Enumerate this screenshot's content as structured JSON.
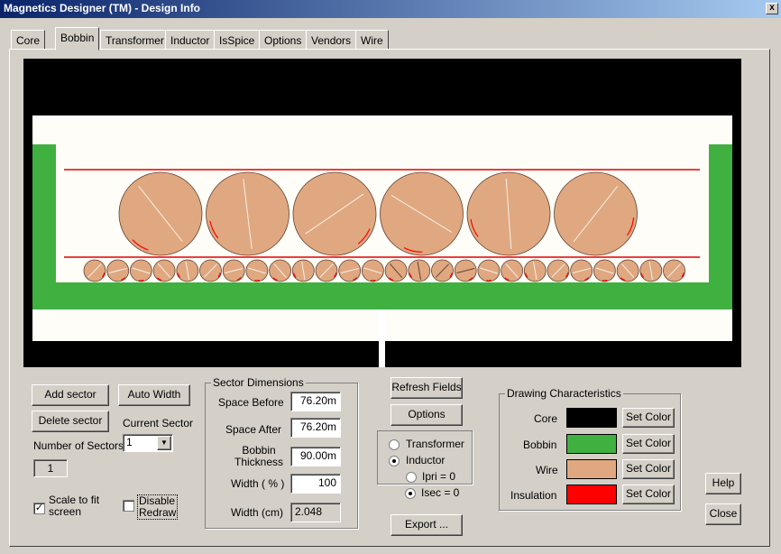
{
  "window": {
    "title": "Magnetics Designer (TM) - Design Info",
    "close_glyph": "x"
  },
  "tabs": [
    "Core",
    "Bobbin",
    "Transformer",
    "Inductor",
    "IsSpice",
    "Options",
    "Vendors",
    "Wire"
  ],
  "buttons": {
    "add_sector": "Add sector",
    "auto_width": "Auto Width",
    "delete_sector": "Delete sector",
    "refresh_fields": "Refresh Fields",
    "options": "Options",
    "export": "Export ...",
    "help": "Help",
    "close": "Close",
    "set_color": "Set Color"
  },
  "labels": {
    "current_sector": "Current Sector",
    "number_of_sectors": "Number of Sectors",
    "scale_to_fit": "Scale to fit",
    "screen": "screen",
    "disable": "Disable",
    "redraw": "Redraw"
  },
  "current_sector_value": "1",
  "number_of_sectors_value": "1",
  "sector_dimensions": {
    "title": "Sector Dimensions",
    "space_before_label": "Space Before",
    "space_before": "76.20m",
    "space_after_label": "Space After",
    "space_after": "76.20m",
    "bobbin_label1": "Bobbin",
    "bobbin_label2": "Thickness",
    "bobbin_thickness": "90.00m",
    "width_pct_label": "Width ( % )",
    "width_pct": "100",
    "width_cm_label": "Width (cm)",
    "width_cm": "2.048"
  },
  "mode": {
    "transformer": "Transformer",
    "inductor": "Inductor",
    "ipri": "Ipri = 0",
    "isec": "Isec = 0"
  },
  "drawing": {
    "title": "Drawing Characteristics",
    "core_label": "Core",
    "bobbin_label": "Bobbin",
    "wire_label": "Wire",
    "insulation_label": "Insulation",
    "colors": {
      "core": "#000000",
      "bobbin": "#40b040",
      "wire": "#e0a880",
      "insulation": "#ff0000"
    }
  },
  "checkboxes": {
    "scale_to_fit_checked": true,
    "disable_redraw_checked": false,
    "check_glyph": "✓"
  },
  "icons": {
    "dropdown": "chevron-down-icon"
  },
  "dropdown_glyph": "▼"
}
